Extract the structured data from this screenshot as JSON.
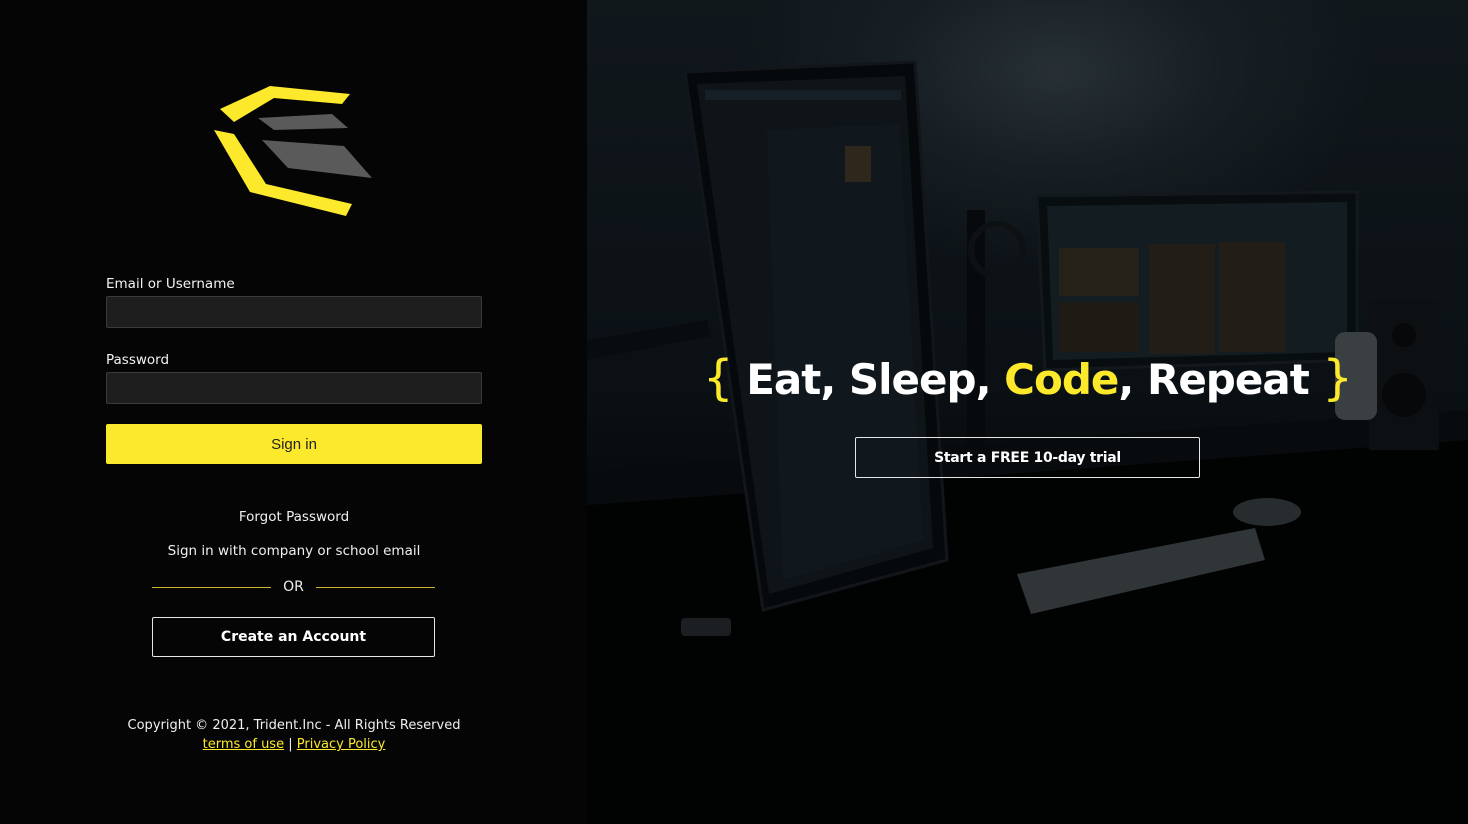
{
  "login": {
    "email_label": "Email or Username",
    "email_value": "",
    "password_label": "Password",
    "password_value": "",
    "signin_label": "Sign in",
    "forgot_label": "Forgot Password",
    "sso_label": "Sign in with company or school email",
    "or_label": "OR",
    "create_label": "Create an Account"
  },
  "footer": {
    "copyright": "Copyright © 2021, Trident.Inc - All Rights Reserved",
    "terms_label": "terms of use",
    "separator": "|",
    "privacy_label": "Privacy Policy"
  },
  "hero": {
    "open_brace": "{",
    "part1": "Eat, Sleep, ",
    "highlight": "Code",
    "part2": ", Repeat",
    "close_brace": "}",
    "trial_label": "Start a FREE 10-day trial"
  },
  "colors": {
    "accent": "#fde92c",
    "background": "#050505",
    "input_bg": "#1e1e1e"
  },
  "icons": {
    "logo": "trident-logo",
    "background": "desk-monitors-photo"
  }
}
